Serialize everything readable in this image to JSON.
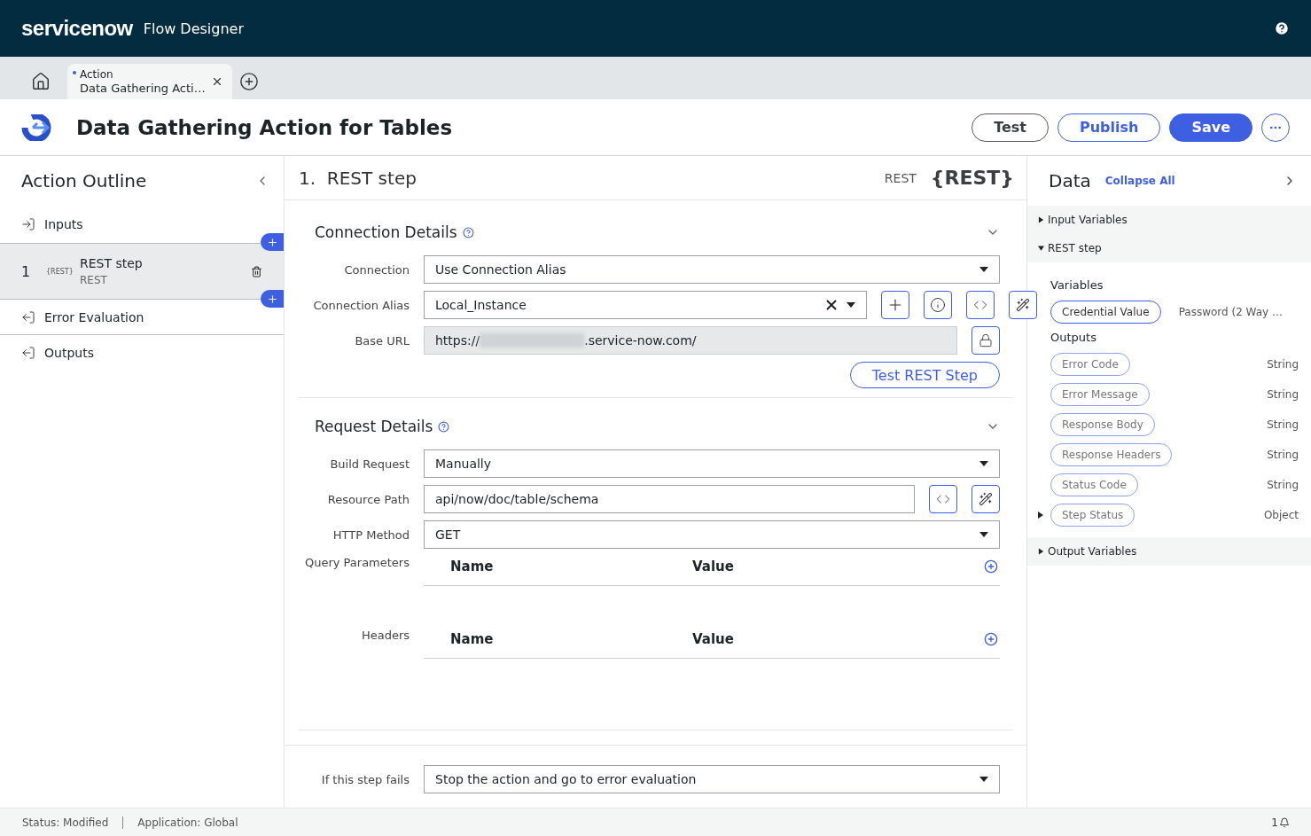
{
  "header": {
    "logo": "servicenow",
    "app_title": "Flow Designer"
  },
  "tabs": [
    {
      "type": "Action",
      "label": "Data Gathering Acti…",
      "selected": true,
      "modified": true
    }
  ],
  "title": "Data Gathering Action for Tables",
  "actions": [
    {
      "kind": "outline",
      "label": "Test"
    },
    {
      "kind": "primary-outline",
      "label": "Publish"
    },
    {
      "kind": "primary",
      "label": "Save"
    }
  ],
  "outline": {
    "title": "Action Outline",
    "items": [
      {
        "kind": "input",
        "label": "Inputs",
        "selected": false
      },
      {
        "kind": "step",
        "number": "1",
        "badge": "{REST}",
        "label": "REST step",
        "sublabel": "REST",
        "selected": true
      },
      {
        "kind": "output",
        "label": "Error Evaluation",
        "selected": false
      },
      {
        "kind": "output",
        "label": "Outputs",
        "selected": false
      }
    ]
  },
  "step": {
    "number": "1.",
    "title": "REST step",
    "type": "REST",
    "badge": "{REST}",
    "sections": [
      {
        "title": "Connection Details",
        "expanded": true,
        "fields": [
          {
            "kind": "select",
            "label": "Connection",
            "value": "Use Connection Alias"
          },
          {
            "kind": "alias",
            "label": "Connection Alias",
            "value": "Local_Instance"
          },
          {
            "kind": "readonly",
            "label": "Base URL",
            "prefix": "https://",
            "value": ".service-now.com/"
          }
        ],
        "button": "Test REST Step"
      },
      {
        "title": "Request Details",
        "expanded": true,
        "fields": [
          {
            "kind": "select",
            "label": "Build Request",
            "value": "Manually"
          },
          {
            "kind": "path",
            "label": "Resource Path",
            "value": "api/now/doc/table/schema"
          },
          {
            "kind": "select",
            "label": "HTTP Method",
            "value": "GET"
          },
          {
            "kind": "table",
            "label": "Query Parameters",
            "columns": [
              "Name",
              "Value"
            ]
          },
          {
            "kind": "table",
            "label": "Headers",
            "columns": [
              "Name",
              "Value"
            ]
          }
        ]
      }
    ],
    "failure": {
      "label": "If this step fails",
      "value": "Stop the action and go to error evaluation"
    }
  },
  "data": {
    "title": "Data",
    "collapse": "Collapse All",
    "groups": [
      {
        "label": "Input Variables",
        "expanded": false
      },
      {
        "label": "REST step",
        "expanded": true,
        "sections": [
          {
            "title": "Variables",
            "kind": "variables",
            "pills": [
              {
                "name": "Credential Value",
                "type": "Password (2 Way …"
              }
            ]
          },
          {
            "title": "Outputs",
            "kind": "outputs",
            "pills": [
              {
                "name": "Error Code",
                "type": "String"
              },
              {
                "name": "Error Message",
                "type": "String"
              },
              {
                "name": "Response Body",
                "type": "String"
              },
              {
                "name": "Response Headers",
                "type": "String"
              },
              {
                "name": "Status Code",
                "type": "String"
              },
              {
                "name": "Step Status",
                "type": "Object",
                "expandable": true
              }
            ]
          }
        ]
      },
      {
        "label": "Output Variables",
        "expanded": false
      }
    ]
  },
  "status_bar": {
    "items": [
      "Status: Modified",
      "Application: Global"
    ],
    "notifications": "1"
  }
}
